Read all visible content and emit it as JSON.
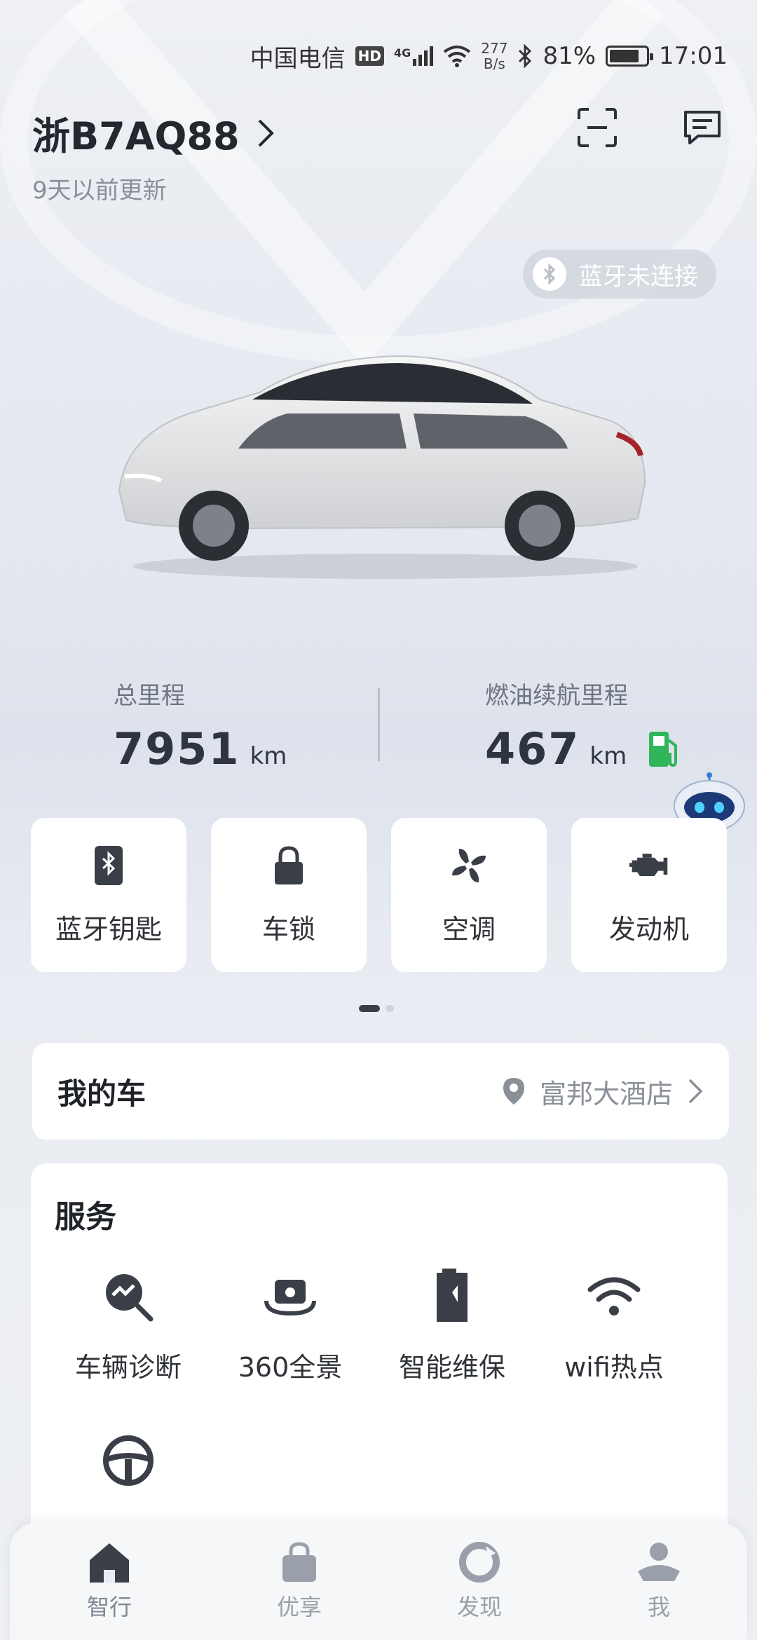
{
  "status_bar": {
    "carrier": "中国电信",
    "hd": "HD",
    "network": "4G",
    "speed_value": "277",
    "speed_unit": "B/s",
    "battery": "81%",
    "battery_level": 0.81,
    "time": "17:01"
  },
  "header": {
    "plate": "浙B7AQ88",
    "updated": "9天以前更新"
  },
  "bluetooth_status": "蓝牙未连接",
  "stats": {
    "total_mileage_label": "总里程",
    "total_mileage_value": "7951",
    "total_mileage_unit": "km",
    "range_label": "燃油续航里程",
    "range_value": "467",
    "range_unit": "km"
  },
  "quick_actions": [
    {
      "label": "蓝牙钥匙",
      "icon": "bluetooth-key-icon"
    },
    {
      "label": "车锁",
      "icon": "lock-icon"
    },
    {
      "label": "空调",
      "icon": "fan-icon"
    },
    {
      "label": "发动机",
      "icon": "engine-icon"
    }
  ],
  "my_car": {
    "title": "我的车",
    "location": "富邦大酒店"
  },
  "services": {
    "title": "服务",
    "items": [
      {
        "label": "车辆诊断",
        "icon": "diagnosis-icon"
      },
      {
        "label": "360全景",
        "icon": "camera-360-icon"
      },
      {
        "label": "智能维保",
        "icon": "maintenance-icon"
      },
      {
        "label": "wifi热点",
        "icon": "wifi-icon"
      },
      {
        "label": "",
        "icon": "steering-wheel-icon"
      }
    ]
  },
  "bottom_nav": [
    {
      "label": "智行",
      "icon": "home-icon",
      "active": true
    },
    {
      "label": "优享",
      "icon": "bag-icon",
      "active": false
    },
    {
      "label": "发现",
      "icon": "discover-icon",
      "active": false
    },
    {
      "label": "我",
      "icon": "profile-icon",
      "active": false
    }
  ],
  "colors": {
    "accent_dark": "#3a3f47",
    "fuel_green": "#2fb55a"
  }
}
